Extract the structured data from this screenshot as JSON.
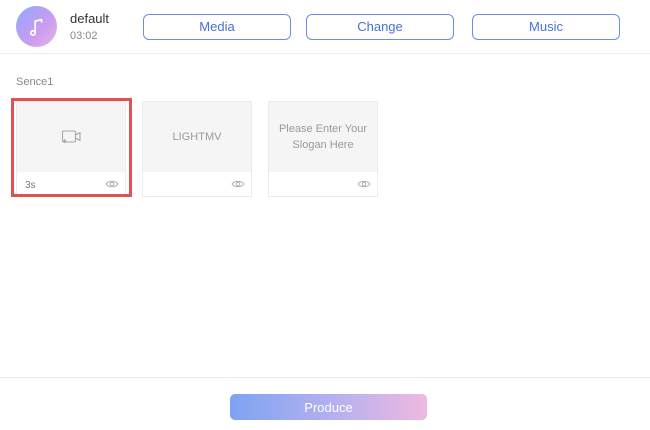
{
  "project": {
    "name": "default",
    "duration": "03:02",
    "avatar_icon": "music-note-icon"
  },
  "toolbar": {
    "media_label": "Media",
    "change_label": "Change",
    "music_label": "Music"
  },
  "scene": {
    "label": "Sence1",
    "cards": [
      {
        "type": "media-placeholder",
        "icon": "add-video-icon",
        "duration": "3s",
        "selected": true
      },
      {
        "type": "text",
        "text": "LIGHTMV",
        "duration": ""
      },
      {
        "type": "text",
        "text": "Please Enter Your Slogan Here",
        "duration": ""
      }
    ]
  },
  "footer": {
    "produce_label": "Produce"
  },
  "colors": {
    "accent": "#4a6fd8",
    "selection": "#e05252",
    "gradient_start": "#7fa2f2",
    "gradient_end": "#efb9df"
  }
}
